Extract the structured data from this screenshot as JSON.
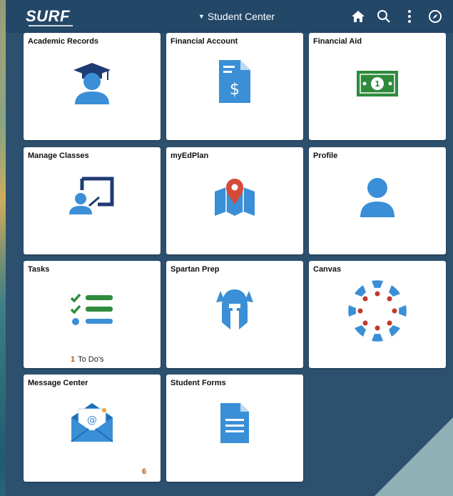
{
  "header": {
    "logo": "SURF",
    "title": "Student Center",
    "icons": [
      "home-icon",
      "search-icon",
      "more-icon",
      "compass-icon"
    ]
  },
  "tiles": [
    {
      "title": "Academic Records",
      "icon": "graduate-icon"
    },
    {
      "title": "Financial Account",
      "icon": "invoice-icon"
    },
    {
      "title": "Financial Aid",
      "icon": "money-icon"
    },
    {
      "title": "Manage Classes",
      "icon": "class-board-icon"
    },
    {
      "title": "myEdPlan",
      "icon": "map-pin-icon"
    },
    {
      "title": "Profile",
      "icon": "person-icon"
    },
    {
      "title": "Tasks",
      "icon": "checklist-icon",
      "count": "1",
      "count_label": "To Do's"
    },
    {
      "title": "Spartan Prep",
      "icon": "spartan-helmet-icon"
    },
    {
      "title": "Canvas",
      "icon": "canvas-icon"
    },
    {
      "title": "Message Center",
      "icon": "envelope-icon",
      "count": "6"
    },
    {
      "title": "Student Forms",
      "icon": "document-icon"
    }
  ],
  "colors": {
    "header": "#234767",
    "panel": "#2c506e",
    "icon_blue": "#3a8fd6",
    "icon_navy": "#1f3b73",
    "money_green": "#2e8b3c",
    "canvas_red": "#c0392b",
    "pin_red": "#d64a3a"
  }
}
